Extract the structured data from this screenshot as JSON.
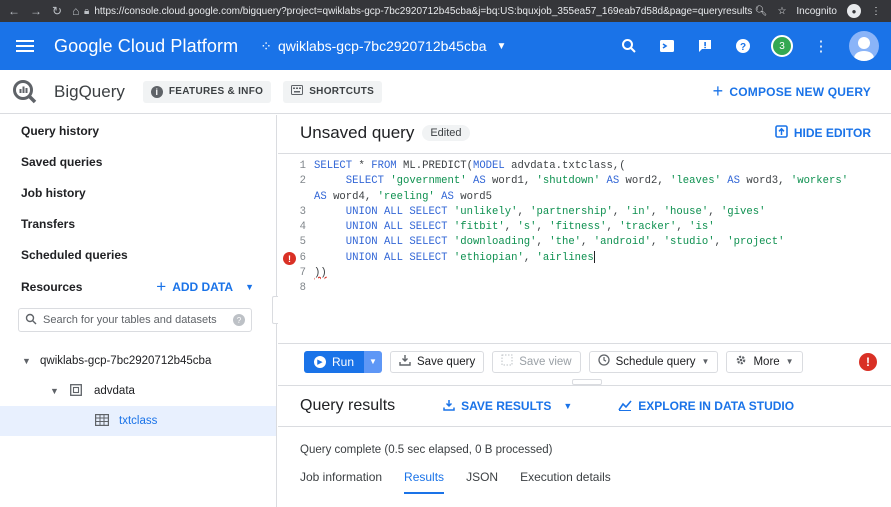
{
  "browser": {
    "url": "https://console.cloud.google.com/bigquery?project=qwiklabs-gcp-7bc2920712b45cba&j=bq:US:bquxjob_355ea57_169eab7d58d&page=queryresults",
    "incognito_label": "Incognito"
  },
  "gcp": {
    "brand": "Google Cloud Platform",
    "project": "qwiklabs-gcp-7bc2920712b45cba",
    "notification_count": "3"
  },
  "bigquery": {
    "title": "BigQuery",
    "features_info": "FEATURES & INFO",
    "shortcuts": "SHORTCUTS",
    "compose": "COMPOSE NEW QUERY"
  },
  "sidebar": {
    "items": [
      "Query history",
      "Saved queries",
      "Job history",
      "Transfers",
      "Scheduled queries"
    ],
    "resources_label": "Resources",
    "add_data": "ADD DATA",
    "search_placeholder": "Search for your tables and datasets",
    "tree": {
      "project": "qwiklabs-gcp-7bc2920712b45cba",
      "dataset": "advdata",
      "table": "txtclass"
    }
  },
  "editor": {
    "title": "Unsaved query",
    "edited_label": "Edited",
    "hide_editor": "HIDE EDITOR",
    "line_numbers": [
      "1",
      "2",
      "",
      "3",
      "4",
      "5",
      "6",
      "7",
      "8"
    ]
  },
  "toolbar": {
    "run": "Run",
    "save_query": "Save query",
    "save_view": "Save view",
    "schedule_query": "Schedule query",
    "more": "More"
  },
  "results": {
    "title": "Query results",
    "save_results": "SAVE RESULTS",
    "explore": "EXPLORE IN DATA STUDIO",
    "status": "Query complete (0.5 sec elapsed, 0 B processed)",
    "tabs": [
      "Job information",
      "Results",
      "JSON",
      "Execution details"
    ]
  },
  "colors": {
    "gcp_blue": "#1a73e8",
    "error_red": "#d93025"
  }
}
